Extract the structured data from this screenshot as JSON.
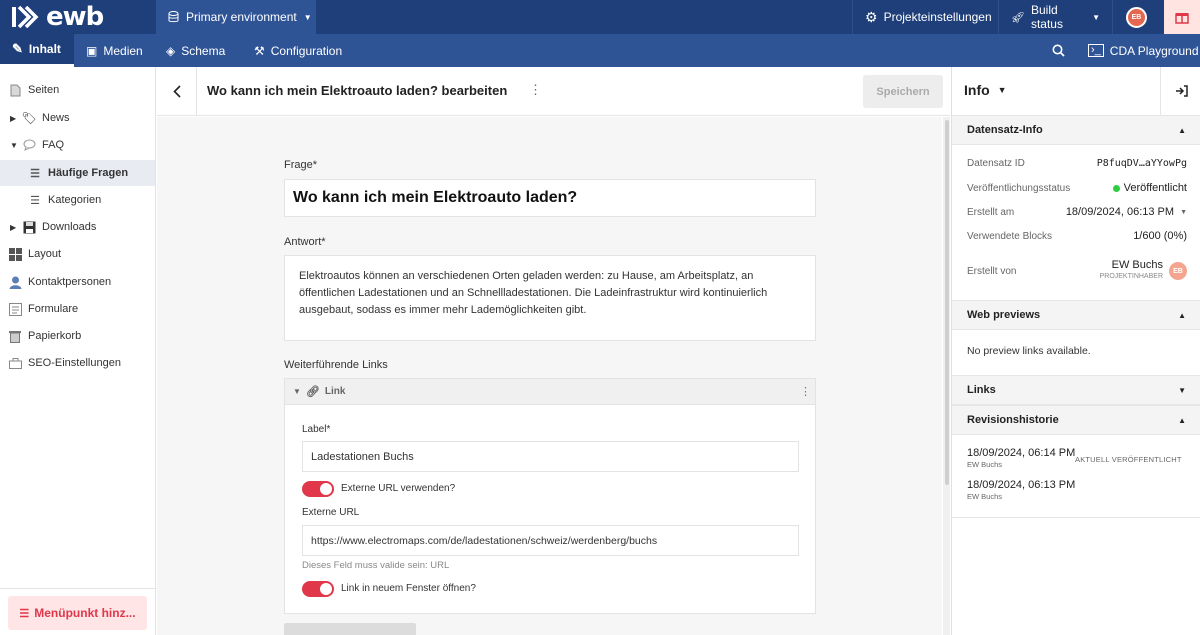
{
  "app": {
    "logo_text": "ewb",
    "environment": "Primary environment",
    "project_settings": "Projekteinstellungen",
    "build_status": "Build status",
    "user_initials": "EB"
  },
  "nav": {
    "tabs": [
      "Inhalt",
      "Medien",
      "Schema",
      "Configuration"
    ],
    "cda_playground": "CDA Playground"
  },
  "sidebar": {
    "items": [
      {
        "label": "Seiten",
        "icon": "page-icon"
      },
      {
        "label": "News",
        "icon": "tag-icon"
      },
      {
        "label": "FAQ",
        "icon": "speech-bubble-icon"
      },
      {
        "label": "Häufige Fragen",
        "icon": "list-icon"
      },
      {
        "label": "Kategorien",
        "icon": "list-icon"
      },
      {
        "label": "Downloads",
        "icon": "floppy-icon"
      },
      {
        "label": "Layout",
        "icon": "grid-icon"
      },
      {
        "label": "Kontaktpersonen",
        "icon": "person-icon"
      },
      {
        "label": "Formulare",
        "icon": "form-icon"
      },
      {
        "label": "Papierkorb",
        "icon": "trash-icon"
      },
      {
        "label": "SEO-Einstellungen",
        "icon": "toolbox-icon"
      }
    ],
    "add_menu_item": "Menüpunkt hinz..."
  },
  "editor": {
    "title": "Wo kann ich mein Elektroauto laden? bearbeiten",
    "save_label": "Speichern",
    "frage_label": "Frage*",
    "frage_value": "Wo kann ich mein Elektroauto laden?",
    "antwort_label": "Antwort*",
    "antwort_value": "Elektroautos können an verschiedenen Orten geladen werden: zu Hause, am Arbeitsplatz, an öffentlichen Ladestationen und an Schnellladestationen. Die Ladeinfrastruktur wird kontinuierlich ausgebaut, sodass es immer mehr Lademöglichkeiten gibt.",
    "links_label": "Weiterführende Links",
    "link_block": {
      "header": "Link",
      "label_label": "Label*",
      "label_value": "Ladestationen Buchs",
      "external_toggle": "Externe URL verwenden?",
      "external_toggle_on": true,
      "url_label": "Externe URL",
      "url_value": "https://www.electromaps.com/de/ladestationen/schweiz/werdenberg/buchs",
      "url_hint": "Dieses Feld muss valide sein: URL",
      "new_window_toggle": "Link in neuem Fenster öffnen?",
      "new_window_on": true
    }
  },
  "info": {
    "title": "Info",
    "record_section": "Datensatz-Info",
    "rows": [
      {
        "label": "Datensatz ID",
        "value": "P8fuqDV…aYYowPg"
      },
      {
        "label": "Veröffentlichungsstatus",
        "value": "Veröffentlicht"
      },
      {
        "label": "Erstellt am",
        "value": "18/09/2024, 06:13 PM"
      },
      {
        "label": "Verwendete Blocks",
        "value": "1/600 (0%)"
      }
    ],
    "created_by_label": "Erstellt von",
    "created_by_name": "EW Buchs",
    "created_by_role": "PROJEKTINHABER",
    "web_previews": "Web previews",
    "no_previews": "No preview links available.",
    "links_section": "Links",
    "revision_section": "Revisionshistorie",
    "revisions": [
      {
        "date": "18/09/2024, 06:14 PM",
        "author": "EW Buchs",
        "badge": "AKTUELL VERÖFFENTLICHT"
      },
      {
        "date": "18/09/2024, 06:13 PM",
        "author": "EW Buchs",
        "badge": ""
      }
    ],
    "status_color": "#2ecc40"
  },
  "colors": {
    "topbar": "#1f3f7a",
    "navbar": "#2f5496",
    "accent": "#e0374b"
  }
}
